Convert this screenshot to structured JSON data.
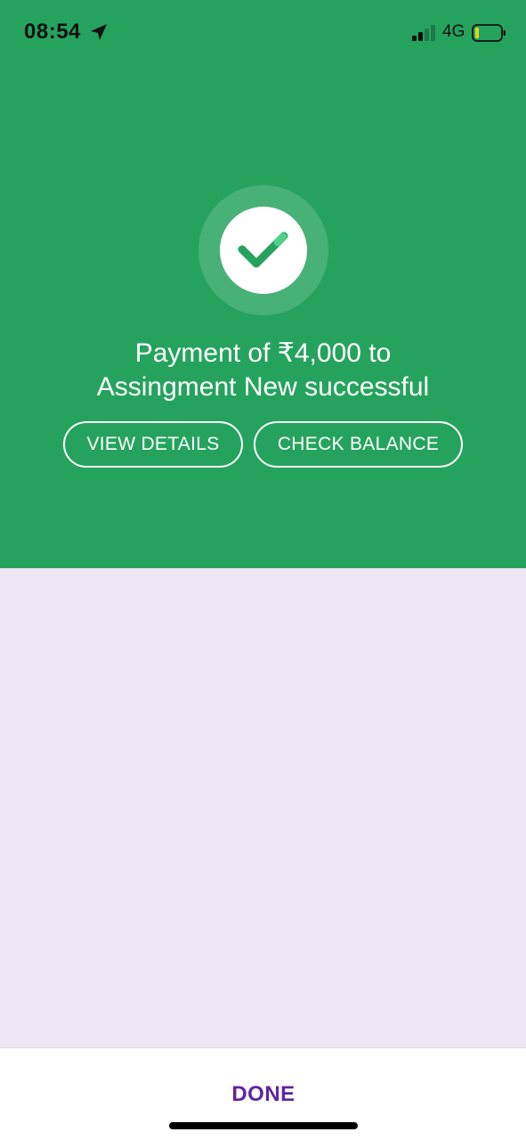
{
  "status_bar": {
    "time": "08:54",
    "network": "4G",
    "icons": [
      "location-arrow-icon",
      "signal-bars-icon",
      "battery-low-icon"
    ]
  },
  "success": {
    "icon": "checkmark-icon",
    "message_line1": "Payment of ₹4,000 to",
    "message_line2": "Assingment New successful"
  },
  "actions": {
    "view_details": "VIEW DETAILS",
    "check_balance": "CHECK BALANCE"
  },
  "footer": {
    "done_label": "DONE"
  },
  "colors": {
    "hero_green": "#25A35E",
    "content_lavender": "#EEE6F5",
    "brand_purple": "#5F259F",
    "battery_yellow": "#E8D21B"
  }
}
